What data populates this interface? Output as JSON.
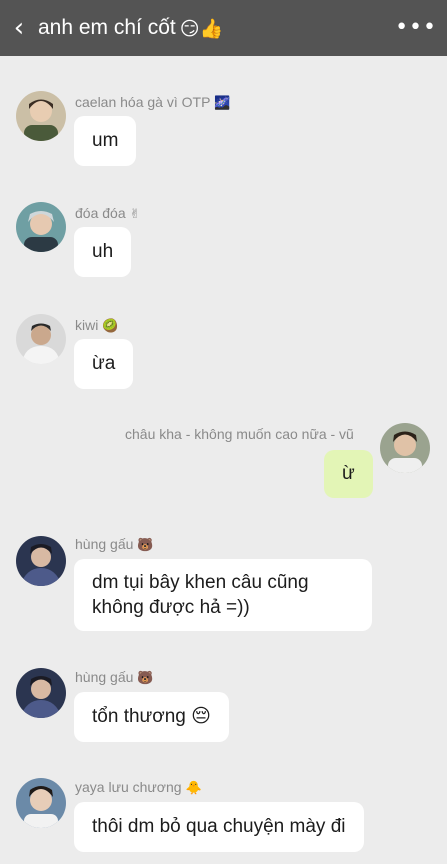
{
  "header": {
    "back_icon": "‹",
    "title": "anh em chí cốt",
    "title_emoji": "😏👍",
    "more_icon": "•••"
  },
  "messages": [
    {
      "sender": "caelan hóa gà vì OTP",
      "badge": "🌌",
      "text": "um",
      "avatar": "user-avatar"
    },
    {
      "sender": "đóa đóa",
      "badge": "✌",
      "text": "uh",
      "avatar": "user-avatar"
    },
    {
      "sender": "kiwi",
      "badge": "🥝",
      "text": "ừa",
      "avatar": "user-avatar"
    },
    {
      "sender": "châu kha - không muốn cao nữa -  vũ",
      "badge": "",
      "text": "ừ",
      "avatar": "user-avatar",
      "mine": true
    },
    {
      "sender": "hùng gấu",
      "badge": "🐻",
      "text": "dm tụi bây khen câu cũng không được hả =))",
      "avatar": "user-avatar"
    },
    {
      "sender": "hùng gấu",
      "badge": "🐻",
      "text": "tổn thương 😔",
      "avatar": "user-avatar"
    },
    {
      "sender": "yaya lưu chương",
      "badge": "🐥",
      "text": "thôi dm bỏ qua chuyện mày đi",
      "avatar": "user-avatar"
    }
  ],
  "colors": {
    "header_bg": "#545454",
    "chat_bg": "#ececec",
    "bubble_other": "#ffffff",
    "bubble_mine": "#e3f5b6"
  }
}
